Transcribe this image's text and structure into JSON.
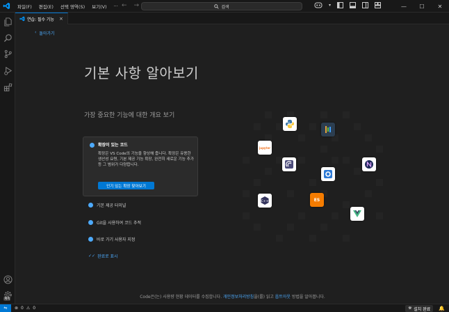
{
  "titlebar": {
    "menus": [
      "파일(F)",
      "편집(E)",
      "선택 영역(S)",
      "보기(V)",
      "···"
    ],
    "search_text": "검색"
  },
  "tab": {
    "label": "연습: 필수 기능",
    "close": "×"
  },
  "walkthrough": {
    "back_label": "돌아가기",
    "title": "기본 사항 알아보기",
    "subtitle": "가장 중요한 기능에 대한 개요 보기",
    "steps": [
      {
        "title": "확장이 있는 코드",
        "description": "확장은 VS Code의 기능을 향상해 줍니다. 확장은 유용한 생산성 요령, 기본 제공 기능 확장, 완전히 새로운 기능 추가 등 그 범위가 다양합니다.",
        "button": "인기 있는 확장 찾아보기"
      },
      {
        "title": "기본 제공 터미널"
      },
      {
        "title": "Git을 사용하여 코드 추적"
      },
      {
        "title": "바로 가기 사용자 지정"
      }
    ],
    "mark_done": "완료로 표시"
  },
  "footer": {
    "text_before": "Code은(는) 사용량 현황 데이터를 수집합니다.",
    "privacy_link": "개인정보처리방침",
    "text_middle": "을(를) 읽고",
    "optout_link": "옵트아웃",
    "text_after": "방법을 알아봅니다."
  },
  "extensions_grid": {
    "tiles": [
      "python-icon",
      "jupyter-icon",
      "remote-icon",
      "github-icon",
      "nx-icon",
      "gitlens-icon",
      "eslint-icon",
      "vue-icon",
      "cpp-icon"
    ],
    "eslint_label": "ES",
    "jupyter_label": "jupyter"
  },
  "statusbar": {
    "errors": "0",
    "warnings": "0",
    "install_label": "설치 완료"
  },
  "activitybar": {
    "account_badge": "계속"
  },
  "colors": {
    "accent": "#0078d4",
    "link": "#4daafc",
    "background": "#1f1f1f"
  }
}
